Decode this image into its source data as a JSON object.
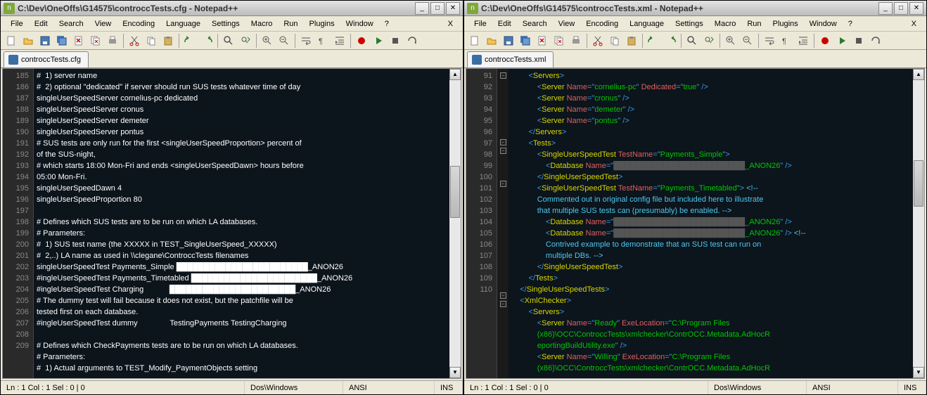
{
  "left": {
    "title": "C:\\Dev\\OneOffs\\G14575\\controccTests.cfg - Notepad++",
    "menus": [
      "File",
      "Edit",
      "Search",
      "View",
      "Encoding",
      "Language",
      "Settings",
      "Macro",
      "Run",
      "Plugins",
      "Window",
      "?"
    ],
    "tab": "controccTests.cfg",
    "first_line": 185,
    "lines": [
      "#  1) server name",
      "#  2) optional \"dedicated\" if server should run SUS tests whatever time of day",
      "singleUserSpeedServer cornelius-pc dedicated",
      "singleUserSpeedServer cronus",
      "singleUserSpeedServer demeter",
      "singleUserSpeedServer pontus",
      "# SUS tests are only run for the first <singleUserSpeedProportion> percent of",
      "of the SUS-night,",
      "# which starts 18:00 Mon-Fri and ends <singleUserSpeedDawn> hours before",
      "05:00 Mon-Fri.",
      "singleUserSpeedDawn 4",
      "singleUserSpeedProportion 80",
      "",
      "# Defines which SUS tests are to be run on which LA databases.",
      "# Parameters:",
      "#  1) SUS test name (the XXXXX in TEST_SingleUserSpeed_XXXXX)",
      "#  2,..) LA name as used in \\\\clegane\\ControccTests filenames",
      "singleUserSpeedTest Payments_Simple ████████████████████████_ANON26",
      "#ingleUserSpeedTest Payments_Timetabled ███████████████████████_ANON26",
      "#ingleUserSpeedTest Charging            ███████████████████████_ANON26",
      "# The dummy test will fail because it does not exist, but the patchfile will be",
      "tested first on each database.",
      "#ingleUserSpeedTest dummy               TestingPayments TestingCharging",
      "",
      "# Defines which CheckPayments tests are to be run on which LA databases.",
      "# Parameters:",
      "#  1) Actual arguments to TEST_Modify_PaymentObjects setting"
    ],
    "wrapped_of": {
      "1": 0,
      "3": 2
    },
    "status": {
      "pos": "Ln : 1  Col : 1  Sel : 0 | 0",
      "eol": "Dos\\Windows",
      "enc": "ANSI",
      "ins": "INS"
    }
  },
  "right": {
    "title": "C:\\Dev\\OneOffs\\G14575\\controccTests.xml - Notepad++",
    "menus": [
      "File",
      "Edit",
      "Search",
      "View",
      "Encoding",
      "Language",
      "Settings",
      "Macro",
      "Run",
      "Plugins",
      "Window",
      "?"
    ],
    "tab": "controccTests.xml",
    "first_line": 91,
    "lines": [
      {
        "ind": 2,
        "segs": [
          {
            "t": "<",
            "c": "b"
          },
          {
            "t": "Servers",
            "c": "y"
          },
          {
            "t": ">",
            "c": "b"
          }
        ],
        "fold": "-"
      },
      {
        "ind": 3,
        "segs": [
          {
            "t": "<",
            "c": "b"
          },
          {
            "t": "Server ",
            "c": "y"
          },
          {
            "t": "Name",
            "c": "r"
          },
          {
            "t": "=\"",
            "c": "b"
          },
          {
            "t": "cornelius-pc",
            "c": "gl"
          },
          {
            "t": "\" ",
            "c": "b"
          },
          {
            "t": "Dedicated",
            "c": "r"
          },
          {
            "t": "=\"",
            "c": "b"
          },
          {
            "t": "true",
            "c": "gl"
          },
          {
            "t": "\" />",
            "c": "b"
          }
        ]
      },
      {
        "ind": 3,
        "segs": [
          {
            "t": "<",
            "c": "b"
          },
          {
            "t": "Server ",
            "c": "y"
          },
          {
            "t": "Name",
            "c": "r"
          },
          {
            "t": "=\"",
            "c": "b"
          },
          {
            "t": "cronus",
            "c": "gl"
          },
          {
            "t": "\" />",
            "c": "b"
          }
        ]
      },
      {
        "ind": 3,
        "segs": [
          {
            "t": "<",
            "c": "b"
          },
          {
            "t": "Server ",
            "c": "y"
          },
          {
            "t": "Name",
            "c": "r"
          },
          {
            "t": "=\"",
            "c": "b"
          },
          {
            "t": "demeter",
            "c": "gl"
          },
          {
            "t": "\" />",
            "c": "b"
          }
        ]
      },
      {
        "ind": 3,
        "segs": [
          {
            "t": "<",
            "c": "b"
          },
          {
            "t": "Server ",
            "c": "y"
          },
          {
            "t": "Name",
            "c": "r"
          },
          {
            "t": "=\"",
            "c": "b"
          },
          {
            "t": "pontus",
            "c": "gl"
          },
          {
            "t": "\" />",
            "c": "b"
          }
        ]
      },
      {
        "ind": 2,
        "segs": [
          {
            "t": "</",
            "c": "b"
          },
          {
            "t": "Servers",
            "c": "y"
          },
          {
            "t": ">",
            "c": "b"
          }
        ]
      },
      {
        "ind": 2,
        "segs": [
          {
            "t": "<",
            "c": "b"
          },
          {
            "t": "Tests",
            "c": "y"
          },
          {
            "t": ">",
            "c": "b"
          }
        ],
        "fold": "-"
      },
      {
        "ind": 3,
        "segs": [
          {
            "t": "<",
            "c": "b"
          },
          {
            "t": "SingleUserSpeedTest ",
            "c": "y"
          },
          {
            "t": "TestName",
            "c": "r"
          },
          {
            "t": "=\"",
            "c": "b"
          },
          {
            "t": "Payments_Simple",
            "c": "gl"
          },
          {
            "t": "\">",
            "c": "b"
          }
        ],
        "fold": "-"
      },
      {
        "ind": 4,
        "segs": [
          {
            "t": "<",
            "c": "b"
          },
          {
            "t": "Database ",
            "c": "y"
          },
          {
            "t": "Name",
            "c": "r"
          },
          {
            "t": "=\"",
            "c": "b"
          },
          {
            "t": "████████████████████████",
            "c": "blur"
          },
          {
            "t": "_ANON26",
            "c": "gl"
          },
          {
            "t": "\" />",
            "c": "b"
          }
        ]
      },
      {
        "ind": 3,
        "segs": [
          {
            "t": "</",
            "c": "b"
          },
          {
            "t": "SingleUserSpeedTest",
            "c": "y"
          },
          {
            "t": ">",
            "c": "b"
          }
        ]
      },
      {
        "ind": 3,
        "segs": [
          {
            "t": "<",
            "c": "b"
          },
          {
            "t": "SingleUserSpeedTest ",
            "c": "y"
          },
          {
            "t": "TestName",
            "c": "r"
          },
          {
            "t": "=\"",
            "c": "b"
          },
          {
            "t": "Payments_Timetabled",
            "c": "gl"
          },
          {
            "t": "\">",
            "c": "b"
          },
          {
            "t": " <!--",
            "c": "c"
          }
        ],
        "fold": "-"
      },
      {
        "ind": 3,
        "segs": [
          {
            "t": "Commented out in original config file but included here to illustrate",
            "c": "c"
          }
        ],
        "cont": true
      },
      {
        "ind": 3,
        "segs": [
          {
            "t": "that multiple SUS tests can (presumably) be enabled. -->",
            "c": "c"
          }
        ],
        "cont": true
      },
      {
        "ind": 4,
        "segs": [
          {
            "t": "<",
            "c": "b"
          },
          {
            "t": "Database ",
            "c": "y"
          },
          {
            "t": "Name",
            "c": "r"
          },
          {
            "t": "=\"",
            "c": "b"
          },
          {
            "t": "████████████████████████",
            "c": "blur"
          },
          {
            "t": "_ANON26",
            "c": "gl"
          },
          {
            "t": "\" />",
            "c": "b"
          }
        ]
      },
      {
        "ind": 4,
        "segs": [
          {
            "t": "<",
            "c": "b"
          },
          {
            "t": "Database ",
            "c": "y"
          },
          {
            "t": "Name",
            "c": "r"
          },
          {
            "t": "=\"",
            "c": "b"
          },
          {
            "t": "████████████████████████",
            "c": "blur"
          },
          {
            "t": "_ANON26",
            "c": "gl"
          },
          {
            "t": "\" />",
            "c": "b"
          },
          {
            "t": " <!--",
            "c": "c"
          }
        ]
      },
      {
        "ind": 4,
        "segs": [
          {
            "t": "Contrived example to demonstrate that an SUS test can run on",
            "c": "c"
          }
        ],
        "cont": true
      },
      {
        "ind": 4,
        "segs": [
          {
            "t": "multiple DBs. -->",
            "c": "c"
          }
        ],
        "cont": true
      },
      {
        "ind": 3,
        "segs": [
          {
            "t": "</",
            "c": "b"
          },
          {
            "t": "SingleUserSpeedTest",
            "c": "y"
          },
          {
            "t": ">",
            "c": "b"
          }
        ]
      },
      {
        "ind": 2,
        "segs": [
          {
            "t": "</",
            "c": "b"
          },
          {
            "t": "Tests",
            "c": "y"
          },
          {
            "t": ">",
            "c": "b"
          }
        ]
      },
      {
        "ind": 1,
        "segs": [
          {
            "t": "</",
            "c": "b"
          },
          {
            "t": "SingleUserSpeedTests",
            "c": "y"
          },
          {
            "t": ">",
            "c": "b"
          }
        ]
      },
      {
        "ind": 1,
        "segs": [
          {
            "t": "<",
            "c": "b"
          },
          {
            "t": "XmlChecker",
            "c": "y"
          },
          {
            "t": ">",
            "c": "b"
          }
        ],
        "fold": "-"
      },
      {
        "ind": 2,
        "segs": [
          {
            "t": "<",
            "c": "b"
          },
          {
            "t": "Servers",
            "c": "y"
          },
          {
            "t": ">",
            "c": "b"
          }
        ],
        "fold": "-"
      },
      {
        "ind": 3,
        "segs": [
          {
            "t": "<",
            "c": "b"
          },
          {
            "t": "Server ",
            "c": "y"
          },
          {
            "t": "Name",
            "c": "r"
          },
          {
            "t": "=\"",
            "c": "b"
          },
          {
            "t": "Ready",
            "c": "gl"
          },
          {
            "t": "\" ",
            "c": "b"
          },
          {
            "t": "ExeLocation",
            "c": "r"
          },
          {
            "t": "=\"",
            "c": "b"
          },
          {
            "t": "C:\\Program Files",
            "c": "gl"
          }
        ]
      },
      {
        "ind": 3,
        "segs": [
          {
            "t": "(x86)\\OCC\\ControccTests\\xmlchecker\\ContrOCC.Metadata.AdHocR",
            "c": "gl"
          }
        ],
        "cont": true
      },
      {
        "ind": 3,
        "segs": [
          {
            "t": "eportingBuildUtility.exe",
            "c": "gl"
          },
          {
            "t": "\" />",
            "c": "b"
          }
        ],
        "cont": true
      },
      {
        "ind": 3,
        "segs": [
          {
            "t": "<",
            "c": "b"
          },
          {
            "t": "Server ",
            "c": "y"
          },
          {
            "t": "Name",
            "c": "r"
          },
          {
            "t": "=\"",
            "c": "b"
          },
          {
            "t": "Willing",
            "c": "gl"
          },
          {
            "t": "\" ",
            "c": "b"
          },
          {
            "t": "ExeLocation",
            "c": "r"
          },
          {
            "t": "=\"",
            "c": "b"
          },
          {
            "t": "C:\\Program Files",
            "c": "gl"
          }
        ]
      },
      {
        "ind": 3,
        "segs": [
          {
            "t": "(x86)\\OCC\\ControccTests\\xmlchecker\\ContrOCC.Metadata.AdHocR",
            "c": "gl"
          }
        ],
        "cont": true
      }
    ],
    "status": {
      "pos": "Ln : 1  Col : 1  Sel : 0 | 0",
      "eol": "Dos\\Windows",
      "enc": "ANSI",
      "ins": "INS"
    }
  },
  "toolbar_icons": [
    "new",
    "open",
    "save",
    "save-all",
    "close",
    "close-all",
    "print",
    "sep",
    "cut",
    "copy",
    "paste",
    "sep",
    "undo",
    "redo",
    "sep",
    "find",
    "replace",
    "sep",
    "zoom-in",
    "zoom-out",
    "sep",
    "wrap",
    "chars",
    "indent",
    "sep",
    "macro-rec",
    "macro-play",
    "macro-stop",
    "macro-repeat"
  ]
}
